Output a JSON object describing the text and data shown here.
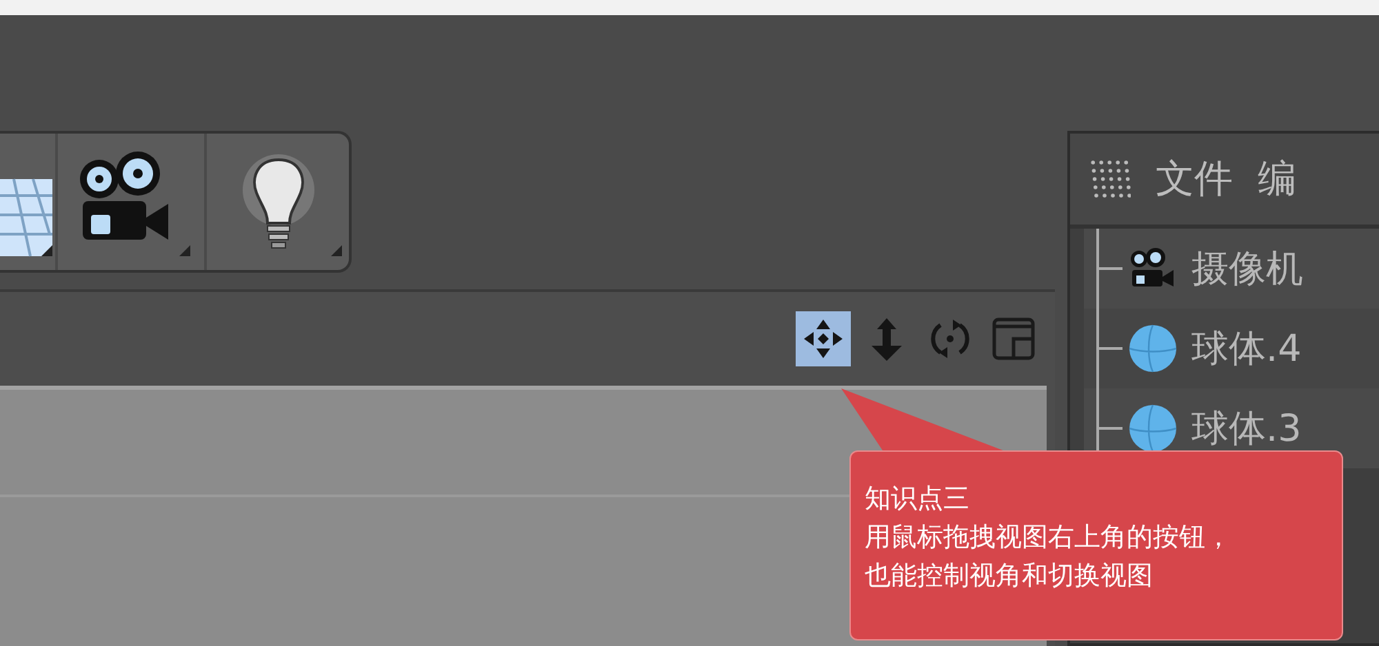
{
  "toolbar": {
    "buttons": [
      {
        "kind": "floor"
      },
      {
        "kind": "camera"
      },
      {
        "kind": "light"
      }
    ]
  },
  "view_controls": [
    {
      "kind": "move",
      "selected": true
    },
    {
      "kind": "zoom",
      "selected": false
    },
    {
      "kind": "rotate",
      "selected": false
    },
    {
      "kind": "switch",
      "selected": false
    }
  ],
  "object_manager": {
    "menu": [
      "文件",
      "编"
    ],
    "objects": [
      {
        "name": "摄像机",
        "kind": "camera"
      },
      {
        "name": "球体.4",
        "kind": "sphere"
      },
      {
        "name": "球体.3",
        "kind": "sphere"
      }
    ]
  },
  "callout": {
    "title": "知识点三",
    "lines": [
      "用鼠标拖拽视图右上角的按钮，",
      "也能控制视角和切换视图"
    ]
  }
}
